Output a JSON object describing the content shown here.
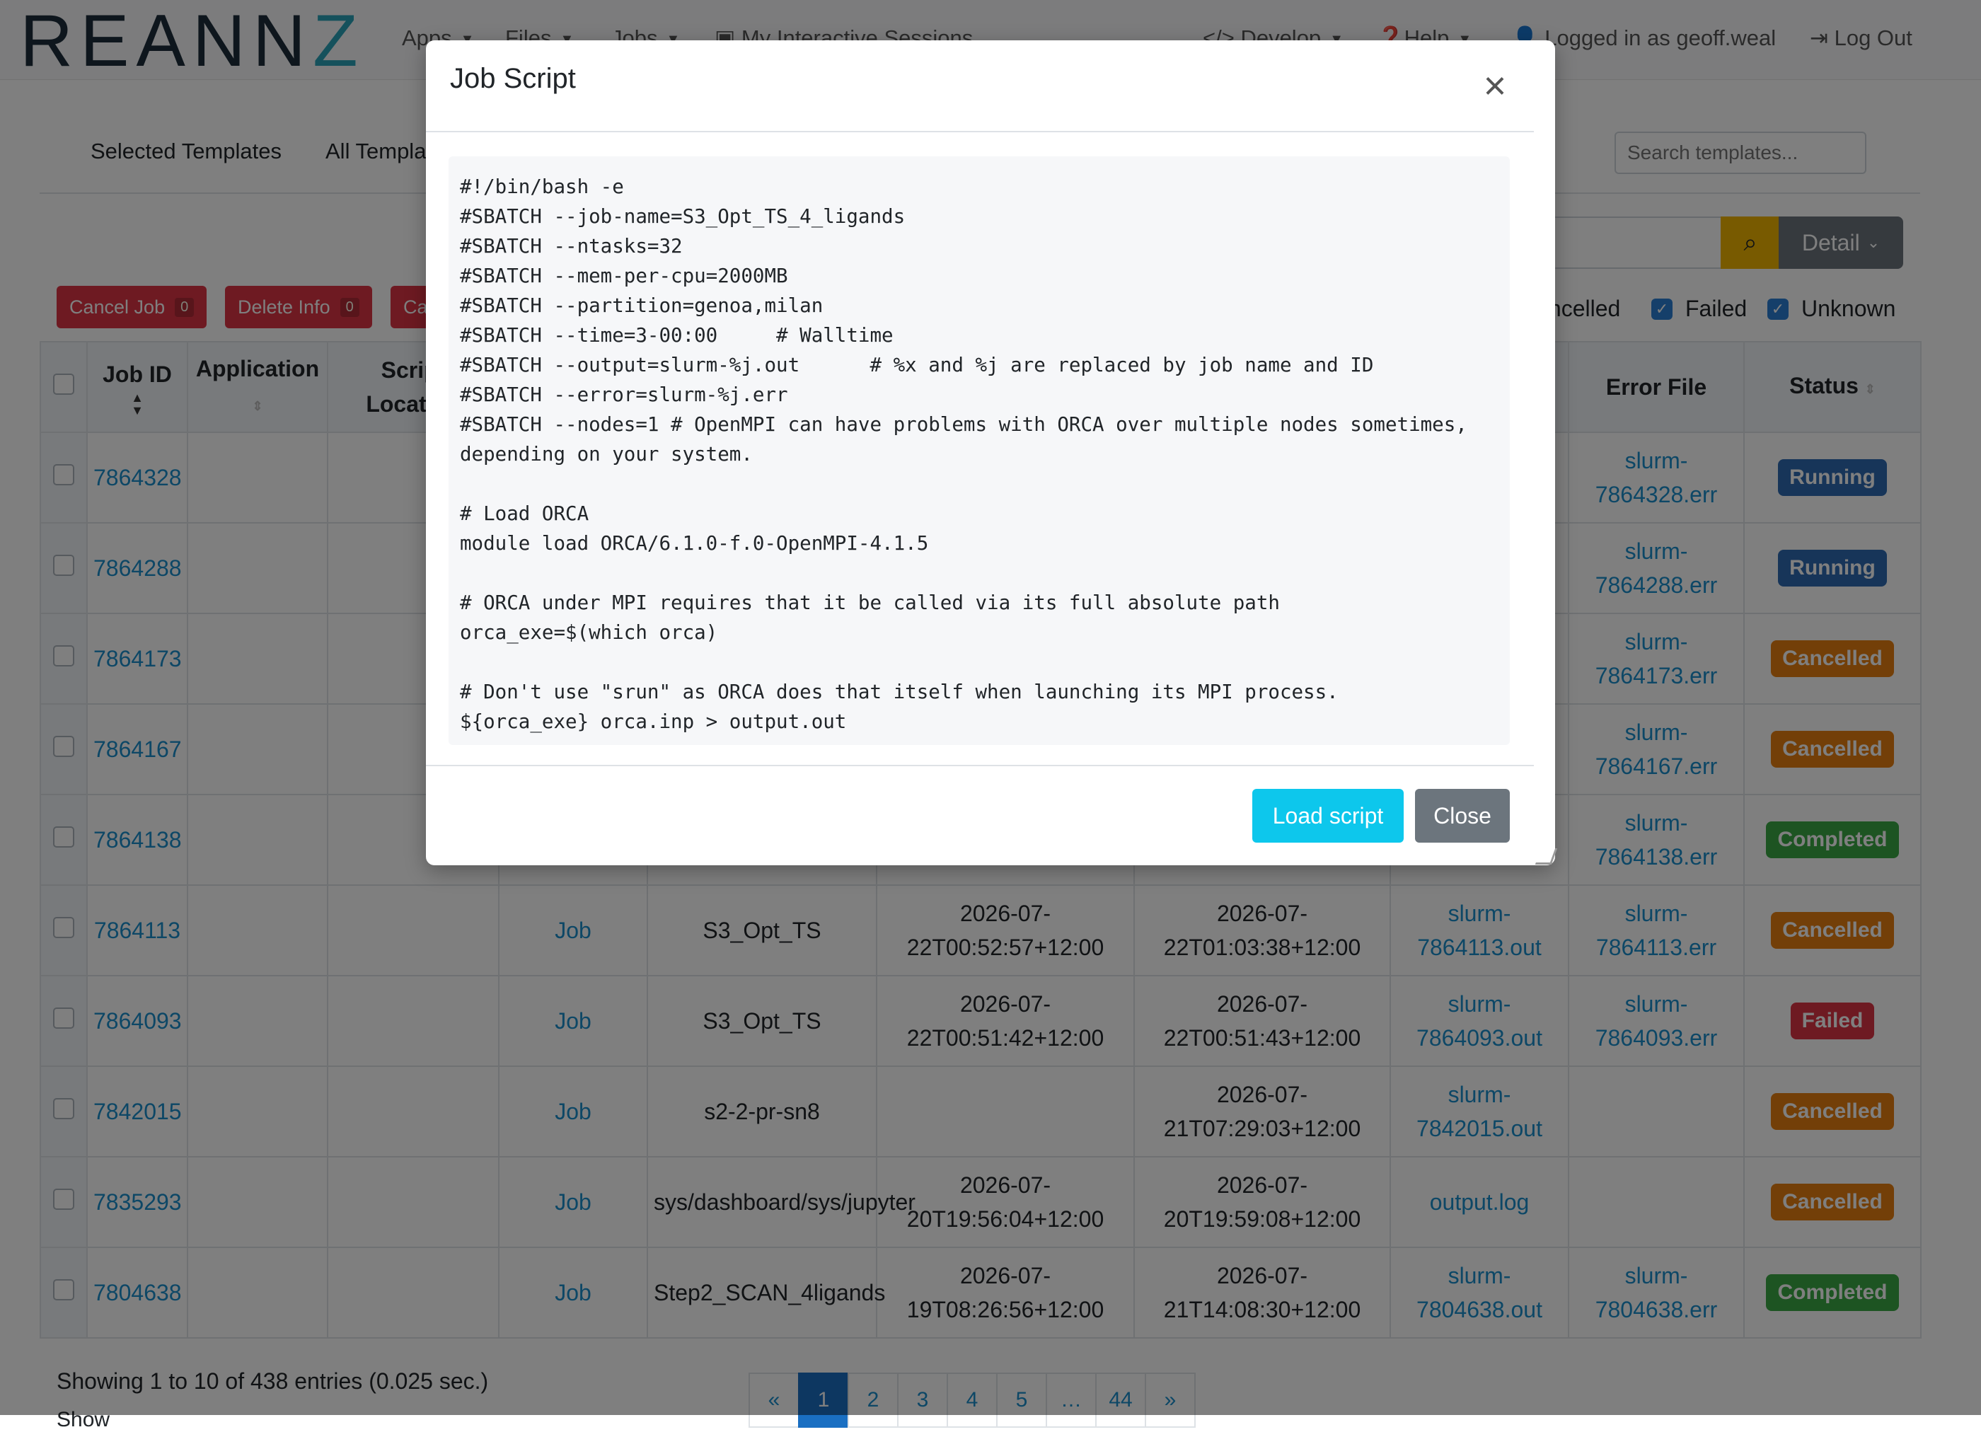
{
  "brand": {
    "part1": "REANN",
    "part2": "Z"
  },
  "nav": {
    "apps": "Apps",
    "files": "Files",
    "jobs": "Jobs",
    "sessions": "My Interactive Sessions",
    "develop": "Develop",
    "help": "Help",
    "user": "Logged in as geoff.weal",
    "logout": "Log Out"
  },
  "tabs": {
    "selected": "Selected Templates",
    "all": "All Templates"
  },
  "search_templates": {
    "placeholder": "Search templates..."
  },
  "toolbar": {
    "detail_label": "Detail",
    "cancel_job": "Cancel Job",
    "cancel_job_count": "0",
    "delete_info": "Delete Info",
    "delete_info_count": "0",
    "third_btn": "Cancel"
  },
  "filters": {
    "cancelled": "Cancelled",
    "failed": "Failed",
    "unknown": "Unknown"
  },
  "table": {
    "headers": {
      "job_id": "Job ID",
      "application": "Application",
      "script_location": "Script Location",
      "error_file": "Error File",
      "status": "Status"
    },
    "rows": [
      {
        "id": "7864328",
        "err": "slurm-7864328.err",
        "status": "Running",
        "status_class": "b-running"
      },
      {
        "id": "7864288",
        "err": "slurm-7864288.err",
        "status": "Running",
        "status_class": "b-running"
      },
      {
        "id": "7864173",
        "err": "slurm-7864173.err",
        "status": "Cancelled",
        "status_class": "b-cancelled"
      },
      {
        "id": "7864167",
        "err": "slurm-7864167.err",
        "status": "Cancelled",
        "status_class": "b-cancelled"
      },
      {
        "id": "7864138",
        "err": "slurm-7864138.err",
        "status": "Completed",
        "status_class": "b-completed"
      },
      {
        "id": "7864113",
        "script": "Job",
        "name": "S3_Opt_TS",
        "submitted": "2026-07-22T00:52:57+12:00",
        "ended": "2026-07-22T01:03:38+12:00",
        "out": "slurm-7864113.out",
        "err": "slurm-7864113.err",
        "status": "Cancelled",
        "status_class": "b-cancelled"
      },
      {
        "id": "7864093",
        "script": "Job",
        "name": "S3_Opt_TS",
        "submitted": "2026-07-22T00:51:42+12:00",
        "ended": "2026-07-22T00:51:43+12:00",
        "out": "slurm-7864093.out",
        "err": "slurm-7864093.err",
        "status": "Failed",
        "status_class": "b-failed"
      },
      {
        "id": "7842015",
        "script": "Job",
        "name": "s2-2-pr-sn8",
        "submitted": "",
        "ended": "2026-07-21T07:29:03+12:00",
        "out": "slurm-7842015.out",
        "err": "",
        "status": "Cancelled",
        "status_class": "b-cancelled"
      },
      {
        "id": "7835293",
        "script": "Job",
        "name": "sys/dashboard/sys/jupyter",
        "submitted": "2026-07-20T19:56:04+12:00",
        "ended": "2026-07-20T19:59:08+12:00",
        "out": "output.log",
        "err": "",
        "status": "Cancelled",
        "status_class": "b-cancelled"
      },
      {
        "id": "7804638",
        "script": "Job",
        "name": "Step2_SCAN_4ligands",
        "submitted": "2026-07-19T08:26:56+12:00",
        "ended": "2026-07-21T14:08:30+12:00",
        "out": "slurm-7804638.out",
        "err": "slurm-7804638.err",
        "status": "Completed",
        "status_class": "b-completed"
      }
    ]
  },
  "footer": {
    "showing": "Showing 1 to 10 of 438 entries (0.025 sec.)",
    "show_label": "Show",
    "pages": [
      "«",
      "1",
      "2",
      "3",
      "4",
      "5",
      "…",
      "44",
      "»"
    ]
  },
  "modal": {
    "title": "Job Script",
    "script": "#!/bin/bash -e\n#SBATCH --job-name=S3_Opt_TS_4_ligands\n#SBATCH --ntasks=32\n#SBATCH --mem-per-cpu=2000MB\n#SBATCH --partition=genoa,milan\n#SBATCH --time=3-00:00     # Walltime\n#SBATCH --output=slurm-%j.out      # %x and %j are replaced by job name and ID\n#SBATCH --error=slurm-%j.err\n#SBATCH --nodes=1 # OpenMPI can have problems with ORCA over multiple nodes sometimes, depending on your system.\n\n# Load ORCA\nmodule load ORCA/6.1.0-f.0-OpenMPI-4.1.5\n\n# ORCA under MPI requires that it be called via its full absolute path\norca_exe=$(which orca)\n\n# Don't use \"srun\" as ORCA does that itself when launching its MPI process.\n${orca_exe} orca.inp > output.out",
    "load_label": "Load script",
    "close_label": "Close"
  }
}
